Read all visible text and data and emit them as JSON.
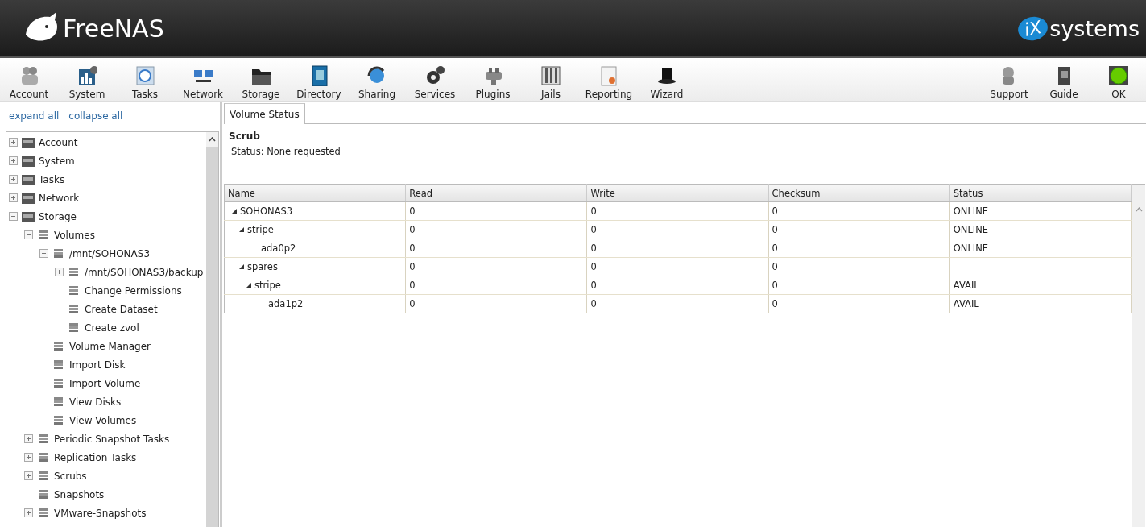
{
  "header": {
    "product": "FreeNAS",
    "vendor": "systems",
    "vendor_mark": "iX"
  },
  "toolbar": {
    "left": [
      {
        "label": "Account"
      },
      {
        "label": "System"
      },
      {
        "label": "Tasks"
      },
      {
        "label": "Network"
      },
      {
        "label": "Storage"
      },
      {
        "label": "Directory"
      },
      {
        "label": "Sharing"
      },
      {
        "label": "Services"
      },
      {
        "label": "Plugins"
      },
      {
        "label": "Jails"
      },
      {
        "label": "Reporting"
      },
      {
        "label": "Wizard"
      }
    ],
    "right": [
      {
        "label": "Support"
      },
      {
        "label": "Guide"
      },
      {
        "label": "OK"
      }
    ]
  },
  "sidebar": {
    "links": [
      "expand all",
      "collapse all"
    ],
    "tree": [
      {
        "label": "Account",
        "kind": "branch",
        "expanded": false
      },
      {
        "label": "System",
        "kind": "branch",
        "expanded": false
      },
      {
        "label": "Tasks",
        "kind": "branch",
        "expanded": false
      },
      {
        "label": "Network",
        "kind": "branch",
        "expanded": false
      },
      {
        "label": "Storage",
        "kind": "branch",
        "expanded": true,
        "children": [
          {
            "label": "Volumes",
            "kind": "branch",
            "expanded": true,
            "children": [
              {
                "label": "/mnt/SOHONAS3",
                "kind": "branch",
                "expanded": true,
                "children": [
                  {
                    "label": "/mnt/SOHONAS3/backup",
                    "kind": "branch",
                    "expanded": false
                  },
                  {
                    "label": "Change Permissions",
                    "kind": "leaf"
                  },
                  {
                    "label": "Create Dataset",
                    "kind": "leaf"
                  },
                  {
                    "label": "Create zvol",
                    "kind": "leaf"
                  }
                ]
              },
              {
                "label": "Volume Manager",
                "kind": "leaf"
              },
              {
                "label": "Import Disk",
                "kind": "leaf"
              },
              {
                "label": "Import Volume",
                "kind": "leaf"
              },
              {
                "label": "View Disks",
                "kind": "leaf"
              },
              {
                "label": "View Volumes",
                "kind": "leaf"
              }
            ]
          },
          {
            "label": "Periodic Snapshot Tasks",
            "kind": "branch",
            "expanded": false
          },
          {
            "label": "Replication Tasks",
            "kind": "branch",
            "expanded": false
          },
          {
            "label": "Scrubs",
            "kind": "branch",
            "expanded": false
          },
          {
            "label": "Snapshots",
            "kind": "leaf"
          },
          {
            "label": "VMware-Snapshots",
            "kind": "branch",
            "expanded": false
          }
        ]
      }
    ]
  },
  "tabs": [
    {
      "label": "Volume Status",
      "selected": true
    }
  ],
  "scrub": {
    "title": "Scrub",
    "status": "Status: None requested"
  },
  "table": {
    "columns": [
      "Name",
      "Read",
      "Write",
      "Checksum",
      "Status"
    ],
    "rows": [
      {
        "name": "SOHONAS3",
        "read": "0",
        "write": "0",
        "checksum": "0",
        "status": "ONLINE",
        "expanded": true,
        "children": [
          {
            "name": "stripe",
            "read": "0",
            "write": "0",
            "checksum": "0",
            "status": "ONLINE",
            "expanded": true,
            "children": [
              {
                "name": "ada0p2",
                "read": "0",
                "write": "0",
                "checksum": "0",
                "status": "ONLINE"
              }
            ]
          },
          {
            "name": "spares",
            "read": "0",
            "write": "0",
            "checksum": "0",
            "expanded": true,
            "children": [
              {
                "name": "stripe",
                "read": "0",
                "write": "0",
                "checksum": "0",
                "status": "AVAIL",
                "expanded": true,
                "children": [
                  {
                    "name": "ada1p2",
                    "read": "0",
                    "write": "0",
                    "checksum": "0",
                    "status": "AVAIL"
                  }
                ]
              }
            ]
          }
        ]
      }
    ]
  }
}
